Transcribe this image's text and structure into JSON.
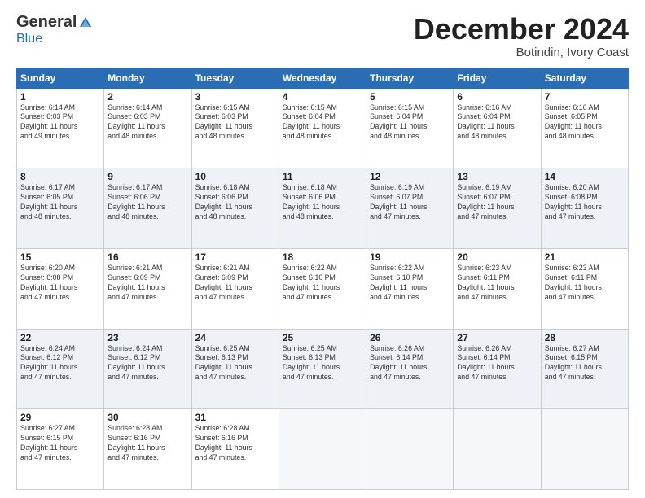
{
  "logo": {
    "general": "General",
    "blue": "Blue"
  },
  "header": {
    "month": "December 2024",
    "location": "Botindin, Ivory Coast"
  },
  "weekdays": [
    "Sunday",
    "Monday",
    "Tuesday",
    "Wednesday",
    "Thursday",
    "Friday",
    "Saturday"
  ],
  "weeks": [
    [
      {
        "day": "1",
        "info": "Sunrise: 6:14 AM\nSunset: 6:03 PM\nDaylight: 11 hours\nand 49 minutes."
      },
      {
        "day": "2",
        "info": "Sunrise: 6:14 AM\nSunset: 6:03 PM\nDaylight: 11 hours\nand 48 minutes."
      },
      {
        "day": "3",
        "info": "Sunrise: 6:15 AM\nSunset: 6:03 PM\nDaylight: 11 hours\nand 48 minutes."
      },
      {
        "day": "4",
        "info": "Sunrise: 6:15 AM\nSunset: 6:04 PM\nDaylight: 11 hours\nand 48 minutes."
      },
      {
        "day": "5",
        "info": "Sunrise: 6:15 AM\nSunset: 6:04 PM\nDaylight: 11 hours\nand 48 minutes."
      },
      {
        "day": "6",
        "info": "Sunrise: 6:16 AM\nSunset: 6:04 PM\nDaylight: 11 hours\nand 48 minutes."
      },
      {
        "day": "7",
        "info": "Sunrise: 6:16 AM\nSunset: 6:05 PM\nDaylight: 11 hours\nand 48 minutes."
      }
    ],
    [
      {
        "day": "8",
        "info": "Sunrise: 6:17 AM\nSunset: 6:05 PM\nDaylight: 11 hours\nand 48 minutes."
      },
      {
        "day": "9",
        "info": "Sunrise: 6:17 AM\nSunset: 6:06 PM\nDaylight: 11 hours\nand 48 minutes."
      },
      {
        "day": "10",
        "info": "Sunrise: 6:18 AM\nSunset: 6:06 PM\nDaylight: 11 hours\nand 48 minutes."
      },
      {
        "day": "11",
        "info": "Sunrise: 6:18 AM\nSunset: 6:06 PM\nDaylight: 11 hours\nand 48 minutes."
      },
      {
        "day": "12",
        "info": "Sunrise: 6:19 AM\nSunset: 6:07 PM\nDaylight: 11 hours\nand 47 minutes."
      },
      {
        "day": "13",
        "info": "Sunrise: 6:19 AM\nSunset: 6:07 PM\nDaylight: 11 hours\nand 47 minutes."
      },
      {
        "day": "14",
        "info": "Sunrise: 6:20 AM\nSunset: 6:08 PM\nDaylight: 11 hours\nand 47 minutes."
      }
    ],
    [
      {
        "day": "15",
        "info": "Sunrise: 6:20 AM\nSunset: 6:08 PM\nDaylight: 11 hours\nand 47 minutes."
      },
      {
        "day": "16",
        "info": "Sunrise: 6:21 AM\nSunset: 6:09 PM\nDaylight: 11 hours\nand 47 minutes."
      },
      {
        "day": "17",
        "info": "Sunrise: 6:21 AM\nSunset: 6:09 PM\nDaylight: 11 hours\nand 47 minutes."
      },
      {
        "day": "18",
        "info": "Sunrise: 6:22 AM\nSunset: 6:10 PM\nDaylight: 11 hours\nand 47 minutes."
      },
      {
        "day": "19",
        "info": "Sunrise: 6:22 AM\nSunset: 6:10 PM\nDaylight: 11 hours\nand 47 minutes."
      },
      {
        "day": "20",
        "info": "Sunrise: 6:23 AM\nSunset: 6:11 PM\nDaylight: 11 hours\nand 47 minutes."
      },
      {
        "day": "21",
        "info": "Sunrise: 6:23 AM\nSunset: 6:11 PM\nDaylight: 11 hours\nand 47 minutes."
      }
    ],
    [
      {
        "day": "22",
        "info": "Sunrise: 6:24 AM\nSunset: 6:12 PM\nDaylight: 11 hours\nand 47 minutes."
      },
      {
        "day": "23",
        "info": "Sunrise: 6:24 AM\nSunset: 6:12 PM\nDaylight: 11 hours\nand 47 minutes."
      },
      {
        "day": "24",
        "info": "Sunrise: 6:25 AM\nSunset: 6:13 PM\nDaylight: 11 hours\nand 47 minutes."
      },
      {
        "day": "25",
        "info": "Sunrise: 6:25 AM\nSunset: 6:13 PM\nDaylight: 11 hours\nand 47 minutes."
      },
      {
        "day": "26",
        "info": "Sunrise: 6:26 AM\nSunset: 6:14 PM\nDaylight: 11 hours\nand 47 minutes."
      },
      {
        "day": "27",
        "info": "Sunrise: 6:26 AM\nSunset: 6:14 PM\nDaylight: 11 hours\nand 47 minutes."
      },
      {
        "day": "28",
        "info": "Sunrise: 6:27 AM\nSunset: 6:15 PM\nDaylight: 11 hours\nand 47 minutes."
      }
    ],
    [
      {
        "day": "29",
        "info": "Sunrise: 6:27 AM\nSunset: 6:15 PM\nDaylight: 11 hours\nand 47 minutes."
      },
      {
        "day": "30",
        "info": "Sunrise: 6:28 AM\nSunset: 6:16 PM\nDaylight: 11 hours\nand 47 minutes."
      },
      {
        "day": "31",
        "info": "Sunrise: 6:28 AM\nSunset: 6:16 PM\nDaylight: 11 hours\nand 47 minutes."
      },
      null,
      null,
      null,
      null
    ]
  ]
}
